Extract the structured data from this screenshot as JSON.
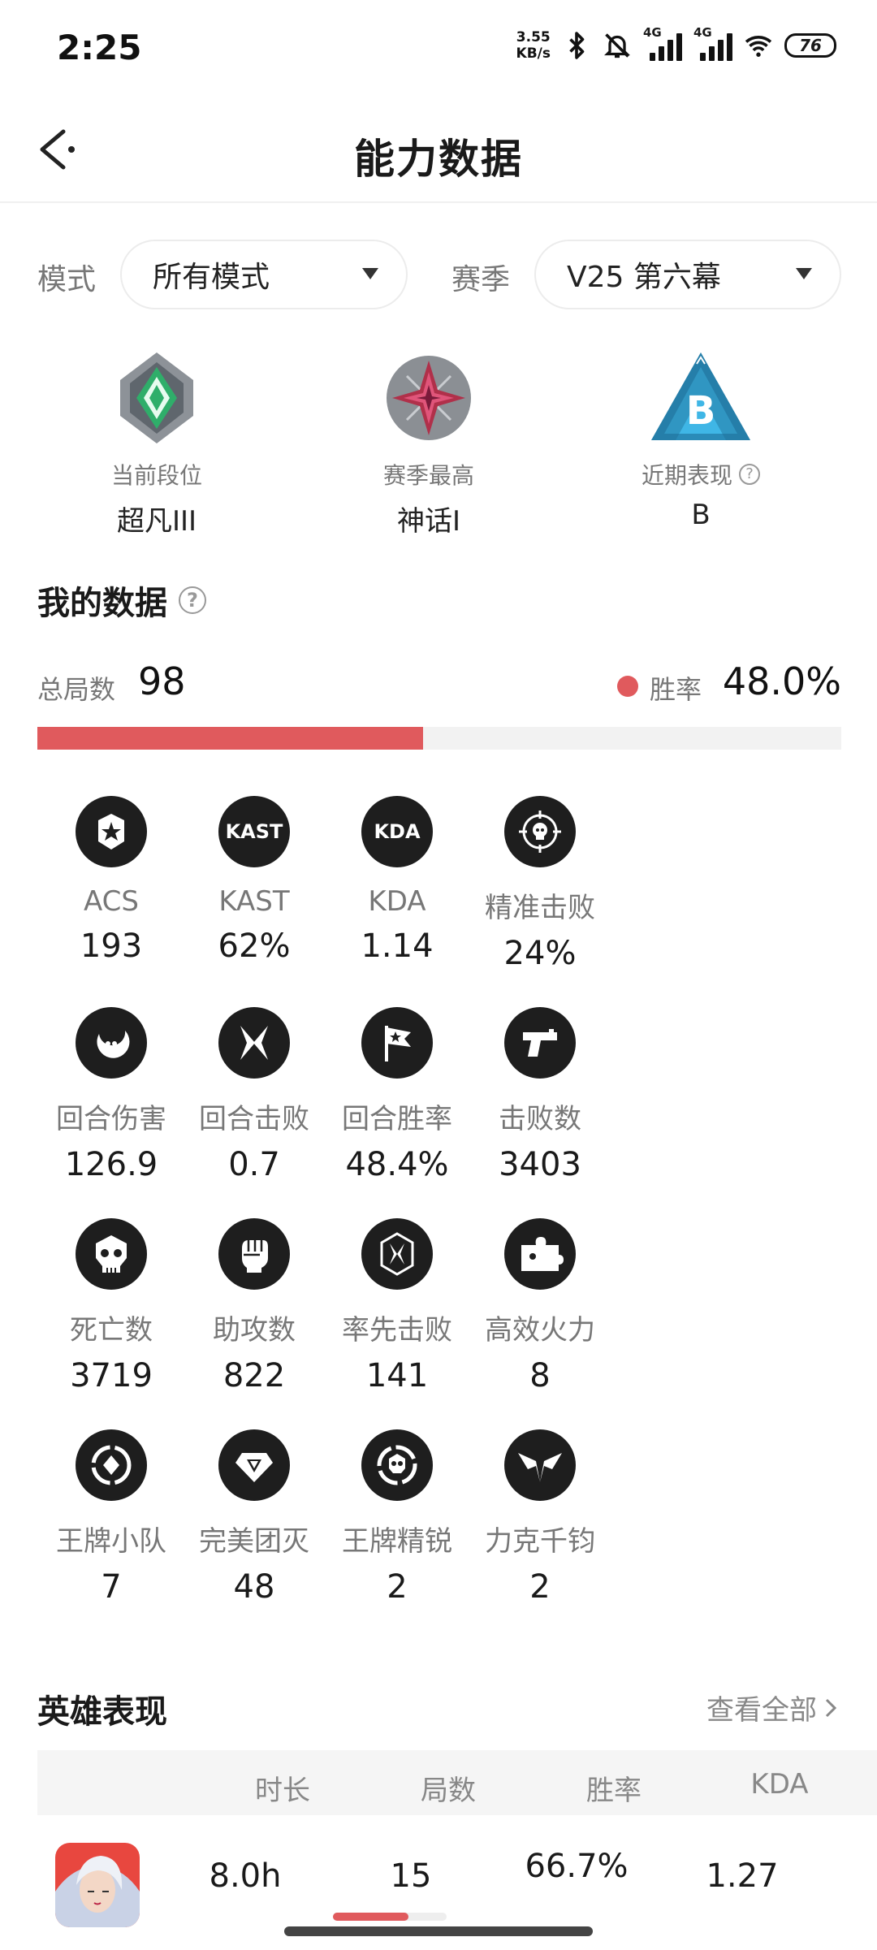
{
  "status_bar": {
    "time": "2:25",
    "net_speed_value": "3.55",
    "net_speed_unit": "KB/s",
    "signal1_tag": "4G",
    "signal2_tag": "4G",
    "battery": "76"
  },
  "header": {
    "title": "能力数据"
  },
  "filters": {
    "mode_label": "模式",
    "mode_value": "所有模式",
    "season_label": "赛季",
    "season_value": "V25 第六幕"
  },
  "ranks": [
    {
      "label": "当前段位",
      "value": "超凡III"
    },
    {
      "label": "赛季最高",
      "value": "神话I"
    },
    {
      "label": "近期表现",
      "value": "B",
      "badge_letter": "B"
    }
  ],
  "my_data": {
    "title": "我的数据",
    "total_label": "总局数",
    "total_value": "98",
    "winrate_label": "胜率",
    "winrate_value": "48.0%",
    "winrate_fraction": 0.48,
    "accent_color": "#e05a5d"
  },
  "stats": [
    {
      "label": "ACS",
      "value": "193",
      "icon": "star-shield-icon"
    },
    {
      "label": "KAST",
      "value": "62%",
      "icon": "kast-icon",
      "icon_text": "KAST"
    },
    {
      "label": "KDA",
      "value": "1.14",
      "icon": "kda-icon",
      "icon_text": "KDA"
    },
    {
      "label": "精准击败",
      "value": "24%",
      "icon": "crosshair-skull-icon"
    },
    {
      "label": "回合伤害",
      "value": "126.9",
      "icon": "crescent-icon"
    },
    {
      "label": "回合击败",
      "value": "0.7",
      "icon": "crossed-blades-icon"
    },
    {
      "label": "回合胜率",
      "value": "48.4%",
      "icon": "flag-icon"
    },
    {
      "label": "击败数",
      "value": "3403",
      "icon": "pistol-icon"
    },
    {
      "label": "死亡数",
      "value": "3719",
      "icon": "skull-icon"
    },
    {
      "label": "助攻数",
      "value": "822",
      "icon": "fist-icon"
    },
    {
      "label": "率先击败",
      "value": "141",
      "icon": "first-blood-icon"
    },
    {
      "label": "高效火力",
      "value": "8",
      "icon": "puzzle-icon"
    },
    {
      "label": "王牌小队",
      "value": "7",
      "icon": "ace-squad-icon"
    },
    {
      "label": "完美团灭",
      "value": "48",
      "icon": "diamond-icon"
    },
    {
      "label": "王牌精锐",
      "value": "2",
      "icon": "elite-skull-icon"
    },
    {
      "label": "力克千钧",
      "value": "2",
      "icon": "winged-icon"
    }
  ],
  "heroes": {
    "title": "英雄表现",
    "view_all": "查看全部",
    "columns": [
      "时长",
      "局数",
      "胜率",
      "KDA"
    ],
    "rows": [
      {
        "duration": "8.0h",
        "games": "15",
        "winrate": "66.7%",
        "winrate_fraction": 0.667,
        "kda": "1.27"
      }
    ]
  }
}
